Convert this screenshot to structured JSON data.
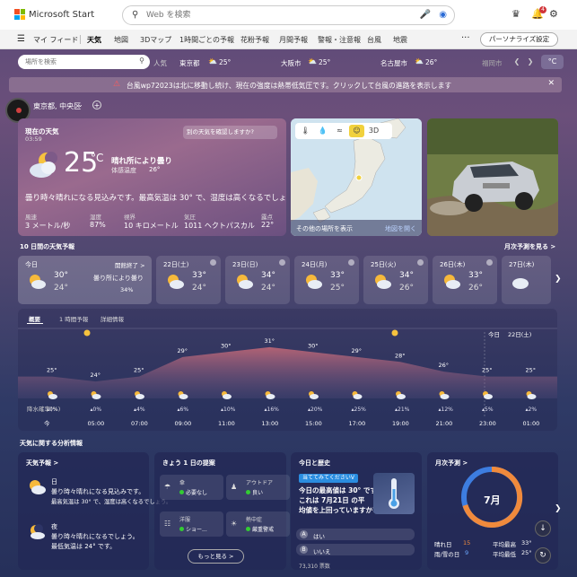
{
  "header": {
    "logo_text": "Microsoft Start",
    "search_placeholder": "Web を検索",
    "notif_count": "4",
    "icons": [
      "search-icon",
      "mic-icon",
      "camera-icon",
      "trophy-icon",
      "bell-icon",
      "gear-icon"
    ]
  },
  "nav": {
    "feed_label": "マイ フィード",
    "items": [
      "天気",
      "地図",
      "3Dマップ",
      "1時間ごとの予報",
      "花粉予報",
      "月間予報",
      "警報・注意報",
      "台風",
      "地震"
    ],
    "active_index": 0,
    "more": "···",
    "personalize": "パーソナライズ設定"
  },
  "citybar": {
    "search_placeholder": "場所を検索",
    "label_popular": "人気",
    "cities": [
      {
        "name": "東京都",
        "temp": "25°"
      },
      {
        "name": "大阪市",
        "temp": "25°"
      },
      {
        "name": "名古屋市",
        "temp": "26°"
      },
      {
        "name": "福岡市",
        "temp": ""
      }
    ],
    "unit": "°C"
  },
  "alert": {
    "text": "台風wp72023は北に移動し続け、現在の強度は熱帯低気圧です。クリックして台風の進路を表示します"
  },
  "location": {
    "name": "東京都, 中央区"
  },
  "current": {
    "title": "現在の天気",
    "time": "03:59",
    "chip": "別の天気を確認しますか?",
    "temp": "25",
    "unit": "°C",
    "condition": "晴れ所により曇り",
    "feels_label": "体感温度",
    "feels_value": "26°",
    "description": "曇り時々晴れになる見込みです。最高気温は 30° で、湿度は高くなるでしょう。",
    "stats": [
      {
        "label": "風速",
        "value": "3 メートル/秒"
      },
      {
        "label": "湿度",
        "value": "87%"
      },
      {
        "label": "視界",
        "value": "10 キロメートル"
      },
      {
        "label": "気圧",
        "value": "1011 ヘクトパスカル"
      },
      {
        "label": "露点",
        "value": "22°"
      }
    ]
  },
  "map": {
    "tools": [
      "温度",
      "降水",
      "風",
      "予報",
      "3D"
    ],
    "footer_left": "その他の場所を表示",
    "footer_right": "地図を開く"
  },
  "tenday": {
    "title": "10 日間の天気予報",
    "link": "月次予測を見る >",
    "today": {
      "name": "今日",
      "end": "開館終了 >",
      "condition": "曇り所により曇り",
      "rain": "34%",
      "hi": "30°",
      "lo": "24°"
    },
    "days": [
      {
        "name": "22日(土)",
        "hi": "33°",
        "lo": "24°"
      },
      {
        "name": "23日(日)",
        "hi": "34°",
        "lo": "24°"
      },
      {
        "name": "24日(月)",
        "hi": "33°",
        "lo": "25°"
      },
      {
        "name": "25日(火)",
        "hi": "34°",
        "lo": "26°"
      },
      {
        "name": "26日(木)",
        "hi": "33°",
        "lo": "26°"
      },
      {
        "name": "27日(木)",
        "hi": "",
        "lo": ""
      }
    ]
  },
  "hourly": {
    "tabs": [
      "概要",
      "1 時間予報",
      "詳細情報"
    ],
    "today_label": "今日",
    "next_label": "22日(土)",
    "rain_label": "降水確率(%)",
    "points": [
      {
        "time": "今",
        "temp": "25°",
        "rain": "0%"
      },
      {
        "time": "05:00",
        "temp": "24°",
        "rain": "0%"
      },
      {
        "time": "07:00",
        "temp": "25°",
        "rain": "4%"
      },
      {
        "time": "09:00",
        "temp": "29°",
        "rain": "6%"
      },
      {
        "time": "11:00",
        "temp": "30°",
        "rain": "10%"
      },
      {
        "time": "13:00",
        "temp": "31°",
        "rain": "16%"
      },
      {
        "time": "15:00",
        "temp": "30°",
        "rain": "20%"
      },
      {
        "time": "17:00",
        "temp": "29°",
        "rain": "25%"
      },
      {
        "time": "19:00",
        "temp": "28°",
        "rain": "21%"
      },
      {
        "time": "21:00",
        "temp": "26°",
        "rain": "12%"
      },
      {
        "time": "23:00",
        "temp": "25°",
        "rain": "5%"
      },
      {
        "time": "01:00",
        "temp": "25°",
        "rain": "2%"
      }
    ]
  },
  "analysis": {
    "title": "天気に関する分析情報",
    "weather_card": {
      "title": "天気予報 >",
      "day_label": "日",
      "day_lines": [
        "曇り時々晴れになる見込みです。",
        "最高気温は 30° で、湿度は高くなるでしょう。"
      ],
      "night_label": "夜",
      "night_lines": [
        "曇り時々晴れになるでしょう。",
        "最低気温は 24° です。"
      ]
    },
    "tips_card": {
      "title": "きょう 1 日の提案",
      "tips": [
        {
          "title": "傘",
          "value": "必要なし"
        },
        {
          "title": "アウトドア",
          "value": "良い"
        },
        {
          "title": "洋服",
          "value": "ショー..."
        },
        {
          "title": "熱中症",
          "value": "厳重警戒"
        }
      ],
      "more": "もっと見る >"
    },
    "history_card": {
      "title": "今日と歴史",
      "badge": "当ててみてくださいV",
      "question": [
        "今日の最高値は 30° です。",
        "これは 7月21日 の平",
        "均値を上回っていますか?"
      ],
      "options": [
        {
          "key": "A",
          "text": "はい"
        },
        {
          "key": "B",
          "text": "いいえ"
        }
      ],
      "votes": "73,310 票数"
    },
    "monthly_card": {
      "title": "月次予測 >",
      "month": "7月",
      "stats": [
        {
          "label": "晴れ日",
          "value": "15"
        },
        {
          "label": "雨/雪の日",
          "value": "9"
        },
        {
          "label": "平均最高",
          "value": "33°"
        },
        {
          "label": "平均最低",
          "value": "25°"
        }
      ]
    }
  }
}
